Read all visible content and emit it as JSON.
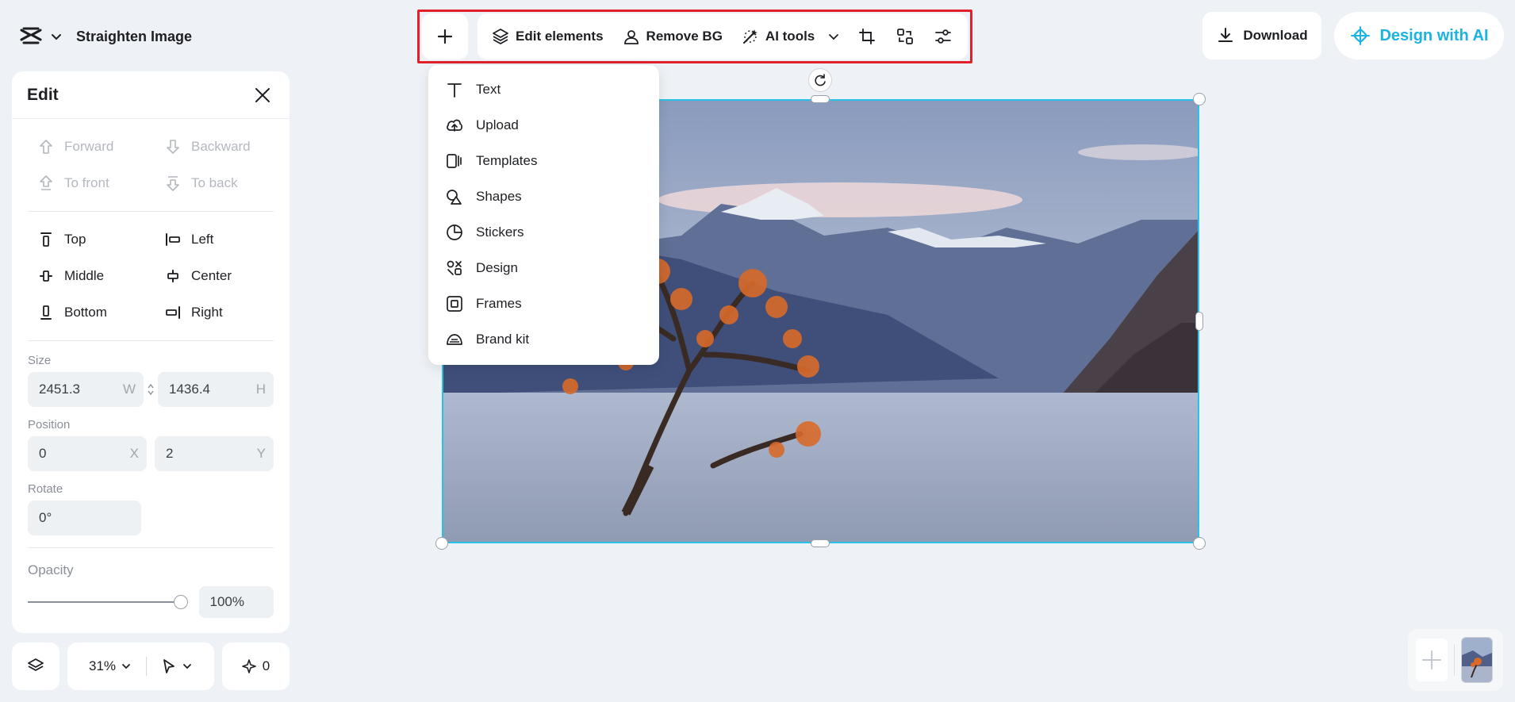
{
  "app": {
    "doc_title": "Straighten Image"
  },
  "toolbar": {
    "edit_elements": "Edit elements",
    "remove_bg": "Remove BG",
    "ai_tools": "AI tools",
    "icons": [
      "plus-icon",
      "layers-icon",
      "person-cutout-icon",
      "magic-wand-icon",
      "chevron-down-icon",
      "crop-icon",
      "flip-icon",
      "sliders-icon"
    ]
  },
  "header_right": {
    "download": "Download",
    "design_with_ai": "Design with AI",
    "accent_color": "#1bb3e0"
  },
  "edit_panel": {
    "title": "Edit",
    "layer_order": [
      {
        "label": "Forward",
        "enabled": false
      },
      {
        "label": "Backward",
        "enabled": false
      },
      {
        "label": "To front",
        "enabled": false
      },
      {
        "label": "To back",
        "enabled": false
      }
    ],
    "align": [
      "Top",
      "Left",
      "Middle",
      "Center",
      "Bottom",
      "Right"
    ],
    "size_label": "Size",
    "width": "2451.3",
    "width_suffix": "W",
    "height": "1436.4",
    "height_suffix": "H",
    "position_label": "Position",
    "x": "0",
    "x_suffix": "X",
    "y": "2",
    "y_suffix": "Y",
    "rotate_label": "Rotate",
    "rotate": "0°",
    "opacity_label": "Opacity",
    "opacity": "100%",
    "opacity_level": 1.0
  },
  "bottom_controls": {
    "zoom": "31%",
    "ai_count": "0"
  },
  "add_menu": {
    "items": [
      "Text",
      "Upload",
      "Templates",
      "Shapes",
      "Stickers",
      "Design",
      "Frames",
      "Brand kit"
    ]
  },
  "colors": {
    "selection": "#28c2e6",
    "highlight": "#e0202b",
    "background": "#eef1f5"
  }
}
